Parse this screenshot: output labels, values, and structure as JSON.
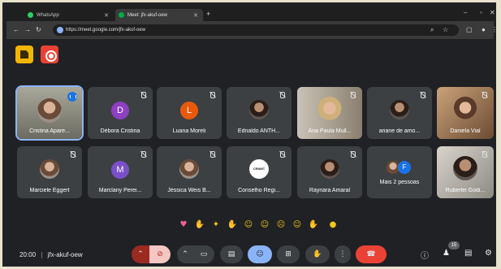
{
  "browser": {
    "tabs": [
      {
        "label": "WhatsApp",
        "color": "#25d366"
      },
      {
        "label": "Meet: jfx-akuf-oew",
        "color": "#00ac47"
      }
    ],
    "url": "https://meet.google.com/jfx-akuf-oew"
  },
  "tiles": [
    {
      "name": "Cristina Apare...",
      "type": "photo",
      "speaking": true
    },
    {
      "name": "Débora Cristina",
      "type": "letter",
      "letter": "D",
      "color": "#8e3fc2"
    },
    {
      "name": "Luana Moreli",
      "type": "letter",
      "letter": "L",
      "color": "#e8590c"
    },
    {
      "name": "Ednaldo ANTH...",
      "type": "photo-dark"
    },
    {
      "name": "Ana Paula Mull...",
      "type": "video"
    },
    {
      "name": "ariane de amo...",
      "type": "photo-dark"
    },
    {
      "name": "Daniela Vial",
      "type": "video"
    },
    {
      "name": "Marciele Eggert",
      "type": "photo"
    },
    {
      "name": "Marclany Perei...",
      "type": "letter",
      "letter": "M",
      "color": "#7b4fc9"
    },
    {
      "name": "Jéssica Weis B...",
      "type": "photo"
    },
    {
      "name": "Conselho Regi...",
      "type": "logo"
    },
    {
      "name": "Raynara Amaral",
      "type": "photo-dark"
    },
    {
      "name": "Mais 2 pessoas",
      "type": "more",
      "letter": "F"
    },
    {
      "name": "Ruberlei Godi...",
      "type": "video"
    }
  ],
  "bottom": {
    "time": "20:00",
    "meeting_code": "jfx-akuf-oew",
    "participants_count": "15"
  }
}
